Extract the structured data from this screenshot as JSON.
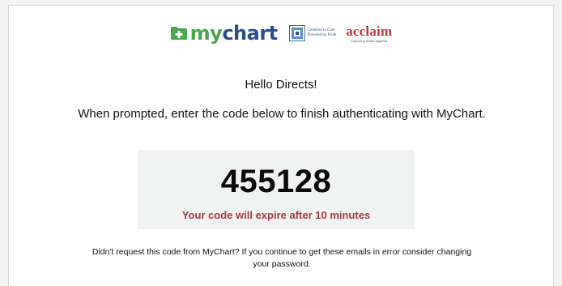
{
  "header": {
    "mychart_logo": {
      "my": "my",
      "chart": "chart",
      "icon": "folder-plus-icon",
      "colors": {
        "green": "#4ca64c",
        "blue": "#2a4f8a"
      }
    },
    "partner_logo": {
      "tagline_line1": "Centered in Care",
      "tagline_line2": "Powered by Pride"
    },
    "acclaim_logo": {
      "name": "acclaim",
      "tagline": "Improving health together",
      "color": "#c8323c"
    }
  },
  "message": {
    "greeting": "Hello Directs!",
    "instruction": "When prompted, enter the code below to finish authenticating with MyChart."
  },
  "code_panel": {
    "code": "455128",
    "expiry": "Your code will expire after 10 minutes",
    "expiry_color": "#a63a48"
  },
  "footer": {
    "note": "Didn't request this code from MyChart? If you continue to get these emails in error consider changing your password."
  }
}
